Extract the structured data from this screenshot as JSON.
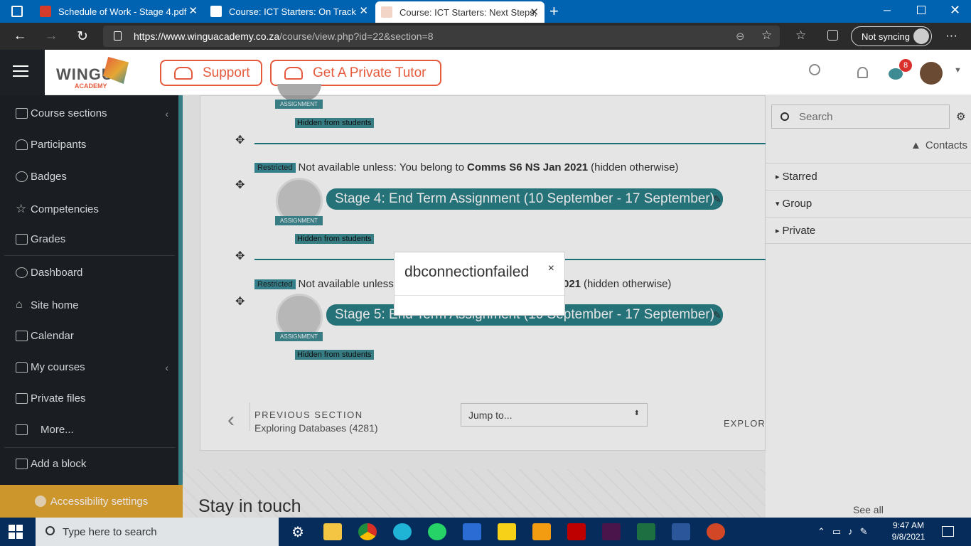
{
  "browser": {
    "tabs": [
      {
        "title": "Schedule of Work - Stage 4.pdf",
        "active": false
      },
      {
        "title": "Course: ICT Starters: On Track",
        "active": false
      },
      {
        "title": "Course: ICT Starters: Next Steps,",
        "active": true
      }
    ],
    "url_domain": "https://www.winguacademy.co.za",
    "url_path": "/course/view.php?id=22&section=8",
    "sync_label": "Not syncing"
  },
  "header": {
    "logo_text": "WINGU",
    "logo_sub": "ACADEMY",
    "support_label": "Support",
    "tutor_label": "Get A Private Tutor",
    "notification_count": "8"
  },
  "sidebar": {
    "items": [
      {
        "label": "Course sections",
        "icon": "folder-icon",
        "chevron": "‹"
      },
      {
        "label": "Participants",
        "icon": "users-icon"
      },
      {
        "label": "Badges",
        "icon": "badge-icon"
      },
      {
        "label": "Competencies",
        "icon": "star-icon"
      },
      {
        "label": "Grades",
        "icon": "grades-icon"
      },
      {
        "label": "Dashboard",
        "icon": "dashboard-icon"
      },
      {
        "label": "Site home",
        "icon": "home-icon"
      },
      {
        "label": "Calendar",
        "icon": "calendar-icon"
      },
      {
        "label": "My courses",
        "icon": "graduation-cap-icon",
        "chevron": "‹"
      },
      {
        "label": "Private files",
        "icon": "file-icon"
      },
      {
        "label": "More...",
        "icon": "folder-icon"
      },
      {
        "label": "Add a block",
        "icon": "folder-icon"
      }
    ],
    "accessibility_label": "Accessibility settings"
  },
  "main": {
    "assignment_label": "ASSIGNMENT",
    "hidden_label": "Hidden from students",
    "restricted_badge": "Restricted",
    "restriction_prefix": "Not available unless: You belong to",
    "restriction_group": "Comms S6 NS Jan 2021",
    "restriction_suffix": "(hidden otherwise)",
    "restriction_prefix_partial": "Not available unless",
    "restriction_partial_tail": "021",
    "activities": [
      {
        "title": "Stage 4: End Term Assignment (10 September - 17 September)"
      },
      {
        "title": "Stage 5: End Term Assignment (10 September - 17 September)"
      }
    ],
    "prev_section_label": "PREVIOUS SECTION",
    "prev_section_name": "Exploring Databases (4281)",
    "jump_placeholder": "Jump to...",
    "next_section_partial": "EXPLORIN",
    "stay_in_touch": "Stay in touch",
    "see_all": "See all"
  },
  "drawer": {
    "search_placeholder": "Search",
    "contacts_label": "Contacts",
    "rows": [
      {
        "label": "Starred",
        "caret": "▸"
      },
      {
        "label": "Group",
        "caret": "▾"
      },
      {
        "label": "Private",
        "caret": "▸"
      }
    ]
  },
  "dialog": {
    "title": "dbconnectionfailed",
    "close": "×"
  },
  "taskbar": {
    "search_placeholder": "Type here to search",
    "time": "9:47 AM",
    "date": "9/8/2021"
  },
  "colors": {
    "teal": "#3f8b93",
    "accent_orange": "#e55a3c",
    "sidebar_bg": "#1d2125",
    "accessibility_bg": "#e5a733"
  }
}
